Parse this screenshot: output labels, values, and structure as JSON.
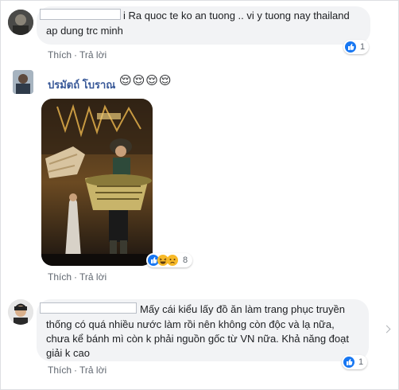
{
  "comments": [
    {
      "text_line1": "i Ra quoc te ko an tuong .. vi y tuong nay thailand",
      "text_line2": "ap dung trc minh",
      "like_label": "Thích",
      "reply_label": "Trả lời",
      "reaction_count": "1"
    },
    {
      "user_name": "ปรมัตถ์ โบราณ",
      "emojis": "😌😌😌😌",
      "like_label": "Thích",
      "reply_label": "Trả lời",
      "reaction_count": "8"
    },
    {
      "text_line1": "Mấy cái kiểu lấy đồ ăn làm trang phục truyền",
      "text_line2": "thống có quá nhiều nước làm rồi nên không còn độc và lạ nữa,",
      "text_line3": "chưa kể bánh mì còn k phải nguồn gốc từ VN nữa. Khả năng đoạt",
      "text_line4": "giải k cao",
      "like_label": "Thích",
      "reply_label": "Trả lời",
      "reaction_count": "1"
    }
  ],
  "colors": {
    "bubble": "#f2f3f5",
    "like_blue": "#1877f2",
    "name_blue": "#385898",
    "action_gray": "#606770"
  }
}
